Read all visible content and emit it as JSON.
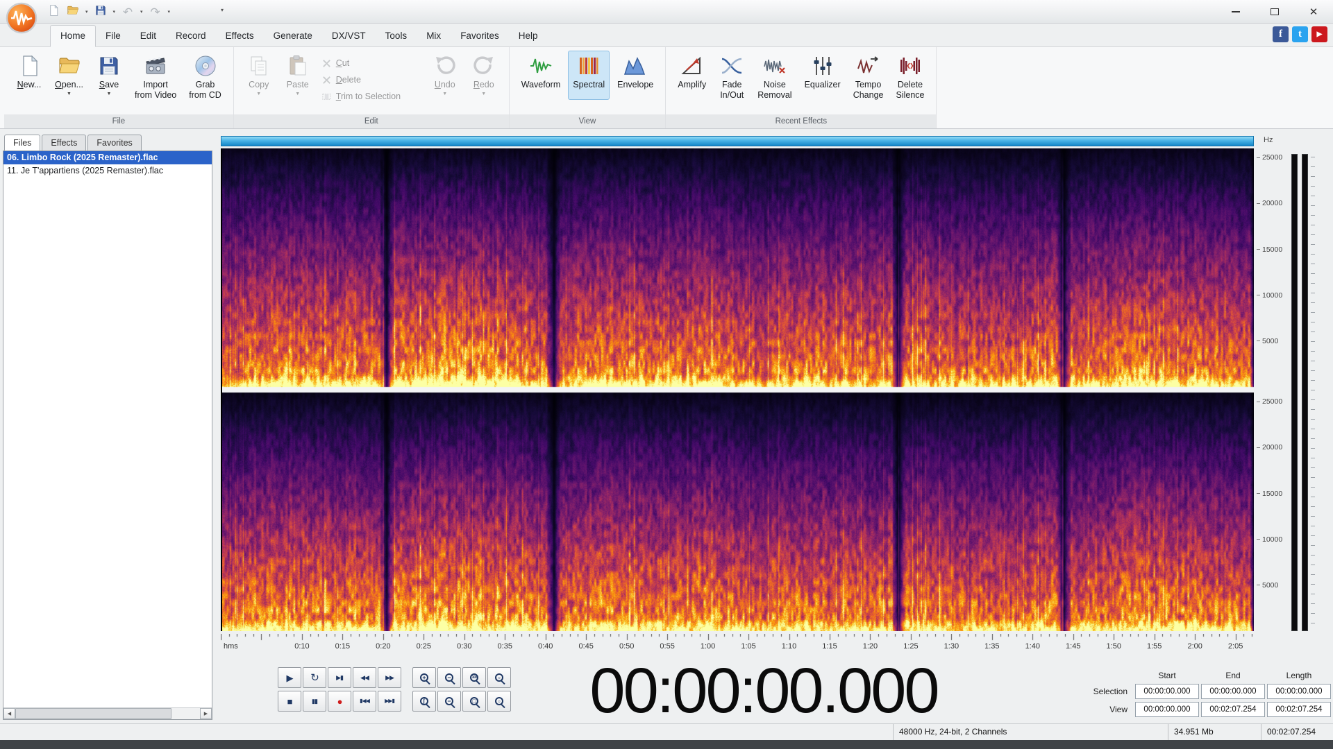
{
  "titlebar": {
    "quick_access": [
      {
        "name": "new-document",
        "glyph": "page"
      },
      {
        "name": "open-file",
        "glyph": "folder",
        "dropdown": true
      },
      {
        "name": "save-file",
        "glyph": "floppy",
        "dropdown": true
      },
      {
        "name": "undo",
        "glyph": "undo-arrow",
        "dropdown": true,
        "disabled": true
      },
      {
        "name": "redo",
        "glyph": "redo-arrow",
        "dropdown": true,
        "disabled": true
      }
    ],
    "window_controls": [
      {
        "name": "minimize"
      },
      {
        "name": "maximize"
      },
      {
        "name": "close"
      }
    ]
  },
  "menu": {
    "tabs": [
      {
        "label": "Home",
        "active": true
      },
      {
        "label": "File"
      },
      {
        "label": "Edit"
      },
      {
        "label": "Record"
      },
      {
        "label": "Effects"
      },
      {
        "label": "Generate"
      },
      {
        "label": "DX/VST"
      },
      {
        "label": "Tools"
      },
      {
        "label": "Mix"
      },
      {
        "label": "Favorites"
      },
      {
        "label": "Help"
      }
    ],
    "social": [
      {
        "name": "facebook",
        "letter": "f",
        "color": "#3b5998"
      },
      {
        "name": "twitter",
        "letter": "t",
        "color": "#2aa3ef"
      },
      {
        "name": "youtube",
        "letter": "▶",
        "color": "#cc181e"
      }
    ]
  },
  "ribbon": {
    "groups": [
      {
        "label": "File",
        "items": [
          {
            "type": "large",
            "label": "New...",
            "u": "N",
            "icon": "new-file"
          },
          {
            "type": "large",
            "label": "Open...",
            "u": "O",
            "icon": "open-folder",
            "dropdown": true
          },
          {
            "type": "large",
            "label": "Save",
            "u": "S",
            "icon": "save-disk",
            "dropdown": true
          },
          {
            "type": "large",
            "label": "Import\nfrom Video",
            "icon": "import-video"
          },
          {
            "type": "large",
            "label": "Grab\nfrom CD",
            "icon": "grab-cd"
          }
        ]
      },
      {
        "label": "Edit",
        "items": [
          {
            "type": "large",
            "label": "Copy",
            "icon": "copy",
            "dropdown": true,
            "disabled": true
          },
          {
            "type": "large",
            "label": "Paste",
            "icon": "paste",
            "dropdown": true,
            "disabled": true
          },
          {
            "type": "stack",
            "items": [
              {
                "label": "Cut",
                "u": "C",
                "icon": "cut",
                "disabled": true
              },
              {
                "label": "Delete",
                "u": "D",
                "icon": "delete",
                "disabled": true
              },
              {
                "label": "Trim to Selection",
                "u": "T",
                "icon": "trim",
                "disabled": true
              }
            ]
          },
          {
            "type": "large",
            "label": "Undo",
            "u": "U",
            "icon": "undo",
            "dropdown": true,
            "disabled": true
          },
          {
            "type": "large",
            "label": "Redo",
            "u": "R",
            "icon": "redo",
            "dropdown": true,
            "disabled": true
          }
        ]
      },
      {
        "label": "View",
        "items": [
          {
            "type": "large",
            "label": "Waveform",
            "icon": "waveform"
          },
          {
            "type": "large",
            "label": "Spectral",
            "icon": "spectral",
            "active": true
          },
          {
            "type": "large",
            "label": "Envelope",
            "icon": "envelope"
          }
        ]
      },
      {
        "label": "Recent Effects",
        "items": [
          {
            "type": "large",
            "label": "Amplify",
            "icon": "amplify"
          },
          {
            "type": "large",
            "label": "Fade\nIn/Out",
            "icon": "fade"
          },
          {
            "type": "large",
            "label": "Noise\nRemoval",
            "icon": "noise"
          },
          {
            "type": "large",
            "label": "Equalizer",
            "icon": "equalizer"
          },
          {
            "type": "large",
            "label": "Tempo\nChange",
            "icon": "tempo"
          },
          {
            "type": "large",
            "label": "Delete\nSilence",
            "icon": "delete-silence"
          }
        ]
      }
    ]
  },
  "sidebar": {
    "tabs": [
      {
        "label": "Files",
        "active": true
      },
      {
        "label": "Effects"
      },
      {
        "label": "Favorites"
      }
    ],
    "files": [
      {
        "label": "06. Limbo Rock (2025 Remaster).flac",
        "selected": true
      },
      {
        "label": "11. Je T'appartiens (2025 Remaster).flac",
        "selected": false
      }
    ]
  },
  "spectro": {
    "freq_unit": "Hz",
    "freq_labels": [
      25000,
      20000,
      15000,
      10000,
      5000
    ],
    "channels": 2,
    "quiet_points_sec": [
      20.4,
      41.0,
      83.4,
      103.8
    ],
    "colormap": "inferno"
  },
  "timeline": {
    "unit": "hms",
    "duration_sec": 127.254,
    "labels": [
      {
        "t": 10,
        "text": "0:10"
      },
      {
        "t": 15,
        "text": "0:15"
      },
      {
        "t": 20,
        "text": "0:20"
      },
      {
        "t": 25,
        "text": "0:25"
      },
      {
        "t": 30,
        "text": "0:30"
      },
      {
        "t": 35,
        "text": "0:35"
      },
      {
        "t": 40,
        "text": "0:40"
      },
      {
        "t": 45,
        "text": "0:45"
      },
      {
        "t": 50,
        "text": "0:50"
      },
      {
        "t": 55,
        "text": "0:55"
      },
      {
        "t": 60,
        "text": "1:00"
      },
      {
        "t": 65,
        "text": "1:05"
      },
      {
        "t": 70,
        "text": "1:10"
      },
      {
        "t": 75,
        "text": "1:15"
      },
      {
        "t": 80,
        "text": "1:20"
      },
      {
        "t": 85,
        "text": "1:25"
      },
      {
        "t": 90,
        "text": "1:30"
      },
      {
        "t": 95,
        "text": "1:35"
      },
      {
        "t": 100,
        "text": "1:40"
      },
      {
        "t": 105,
        "text": "1:45"
      },
      {
        "t": 110,
        "text": "1:50"
      },
      {
        "t": 115,
        "text": "1:55"
      },
      {
        "t": 120,
        "text": "2:00"
      },
      {
        "t": 125,
        "text": "2:05"
      }
    ]
  },
  "transport": {
    "row1": [
      {
        "name": "play",
        "glyph": "play"
      },
      {
        "name": "loop",
        "glyph": "loop"
      },
      {
        "name": "play-to-end",
        "glyph": "play-to-end"
      },
      {
        "name": "rewind",
        "glyph": "rewind"
      },
      {
        "name": "fast-forward",
        "glyph": "fast-forward"
      },
      {
        "name": "zoom-in",
        "mag": "+"
      },
      {
        "name": "zoom-out",
        "mag": "−"
      },
      {
        "name": "zoom-full",
        "mag": "100"
      },
      {
        "name": "zoom-selection",
        "mag": "▫"
      }
    ],
    "row2": [
      {
        "name": "stop",
        "glyph": "stop"
      },
      {
        "name": "pause",
        "glyph": "pause"
      },
      {
        "name": "record",
        "glyph": "record"
      },
      {
        "name": "go-to-start",
        "glyph": "skip-start"
      },
      {
        "name": "go-to-end",
        "glyph": "skip-end"
      },
      {
        "name": "zoom-vertical-in",
        "mag": "["
      },
      {
        "name": "zoom-vertical-out",
        "mag": "−"
      },
      {
        "name": "zoom-project",
        "mag": "□"
      },
      {
        "name": "zoom-to-selection",
        "mag": "▫"
      }
    ]
  },
  "time_display": "00:00:00.000",
  "selection_panel": {
    "headers": [
      "Start",
      "End",
      "Length"
    ],
    "rows": [
      {
        "label": "Selection",
        "values": [
          "00:00:00.000",
          "00:00:00.000",
          "00:00:00.000"
        ]
      },
      {
        "label": "View",
        "values": [
          "00:00:00.000",
          "00:02:07.254",
          "00:02:07.254"
        ]
      }
    ]
  },
  "statusbar": {
    "format": "48000 Hz, 24-bit, 2 Channels",
    "size": "34.951 Mb",
    "duration": "00:02:07.254"
  },
  "colors": {
    "selection_blue": "#2b63c9",
    "record_red": "#cf1d1d",
    "overview_bar_blue": "#1486c9",
    "ribbon_active_bg": "#cde6f7"
  }
}
